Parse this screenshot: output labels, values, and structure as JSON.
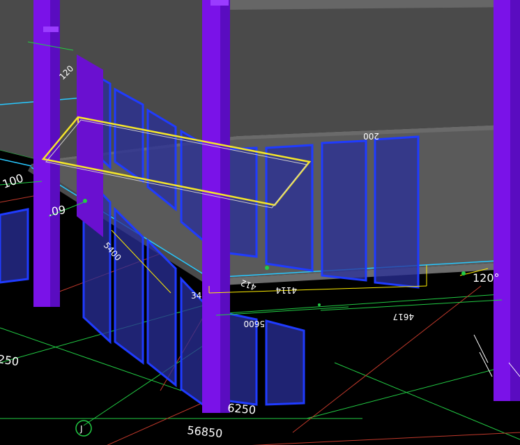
{
  "viewport": {
    "background": "#000000"
  },
  "colors": {
    "column": "#7a12e8",
    "column_dark": "#4e0a9c",
    "slab": "#555555",
    "slab_edge": "#8a8a8a",
    "window_fill": "#2a2f9a",
    "window_edge": "#1f3bff",
    "grid_green": "#22cc44",
    "grid_red": "#c0392b",
    "dim_yellow": "#ffee00",
    "selection_yellow": "#f5e62a",
    "cyan": "#28c8ff",
    "text": "#ffffff"
  },
  "dimensions": {
    "d_100": "100",
    "d_60": ".09",
    "d_5400": "5400",
    "d_34": "34",
    "d_5600": "5600",
    "d_4617": "4617",
    "d_4114": "4114",
    "d_412": "412",
    "d_120": "120°",
    "d_6250_bottom": "6250",
    "d_6250_left": "250",
    "d_56850": "56850",
    "d_200": "200",
    "d_120_top": "120"
  },
  "grid_labels": {
    "axis_j": "J"
  }
}
